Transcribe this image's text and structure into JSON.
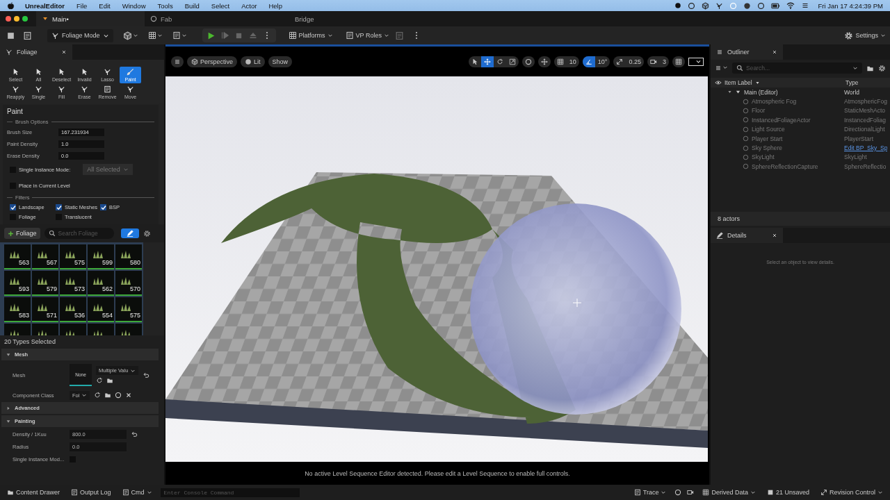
{
  "menubar": {
    "app": "UnrealEditor",
    "items": [
      "File",
      "Edit",
      "Window",
      "Tools",
      "Build",
      "Select",
      "Actor",
      "Help"
    ],
    "clock": "Fri Jan 17  4:24:39 PM"
  },
  "tabs": [
    {
      "label": "Main•",
      "selected": true
    },
    {
      "label": "Fab",
      "selected": false
    }
  ],
  "window_title": "Bridge",
  "toolbar": {
    "mode": "Foliage Mode",
    "platforms": "Platforms",
    "vp_roles": "VP Roles",
    "settings": "Settings"
  },
  "foliage_panel": {
    "title": "Foliage",
    "tools": [
      {
        "label": "Select",
        "selected": false
      },
      {
        "label": "All",
        "selected": false
      },
      {
        "label": "Deselect",
        "selected": false
      },
      {
        "label": "Invalid",
        "selected": false
      },
      {
        "label": "Lasso",
        "selected": false
      },
      {
        "label": "Paint",
        "selected": true
      },
      {
        "label": "Reapply",
        "selected": false
      },
      {
        "label": "Single",
        "selected": false
      },
      {
        "label": "Fill",
        "selected": false
      },
      {
        "label": "Erase",
        "selected": false
      },
      {
        "label": "Remove",
        "selected": false
      },
      {
        "label": "Move",
        "selected": false
      }
    ],
    "heading": "Paint",
    "brush_options": "Brush Options",
    "fields": [
      {
        "label": "Brush Size",
        "value": "167.231934"
      },
      {
        "label": "Paint Density",
        "value": "1.0"
      },
      {
        "label": "Erase Density",
        "value": "0.0"
      }
    ],
    "single_instance": {
      "label": "Single Instance Mode:",
      "checked": false,
      "dropdown": "All Selected"
    },
    "place_in_level": {
      "label": "Place in Current Level",
      "checked": false
    },
    "filters_heading": "Filters",
    "filters": [
      {
        "label": "Landscape",
        "checked": true
      },
      {
        "label": "Static Meshes",
        "checked": true
      },
      {
        "label": "BSP",
        "checked": true
      },
      {
        "label": "Foliage",
        "checked": false
      },
      {
        "label": "Translucent",
        "checked": false
      }
    ],
    "add_button": "Foliage",
    "search_placeholder": "Search Foliage",
    "thumbnails": [
      "563",
      "567",
      "575",
      "599",
      "580",
      "593",
      "579",
      "573",
      "562",
      "570",
      "583",
      "571",
      "536",
      "554",
      "575"
    ],
    "selection": "20 Types Selected",
    "sections": [
      {
        "title": "Mesh",
        "expanded": true,
        "rows": [
          {
            "kind": "mesh",
            "label": "Mesh",
            "thumb": "None",
            "value": "Multiple Valu"
          },
          {
            "kind": "class",
            "label": "Component Class",
            "value": "Fol"
          }
        ]
      },
      {
        "title": "Advanced",
        "expanded": false
      },
      {
        "title": "Painting",
        "expanded": true,
        "rows": [
          {
            "kind": "number",
            "label": "Density / 1Kuu",
            "value": "800.0"
          },
          {
            "kind": "number",
            "label": "Radius",
            "value": "0.0"
          },
          {
            "kind": "check",
            "label": "Single Instance Mod...",
            "checked": false
          }
        ]
      }
    ]
  },
  "viewport": {
    "views": [
      "Perspective",
      "Lit",
      "Show"
    ],
    "grid": "10",
    "angle": "10°",
    "angle_on": true,
    "scale": "0.25",
    "camera": "3",
    "message": "No active Level Sequence Editor detected. Please edit a Level Sequence to enable full controls."
  },
  "outliner": {
    "title": "Outliner",
    "search_placeholder": "Search...",
    "columns": [
      "Item Label",
      "Type"
    ],
    "root": {
      "label": "Main (Editor)",
      "type": "World",
      "expanded": true,
      "children": [
        {
          "label": "Atmospheric Fog",
          "type": "AtmosphericFog",
          "kind": "text"
        },
        {
          "label": "Floor",
          "type": "StaticMeshActo",
          "kind": "text"
        },
        {
          "label": "InstancedFoliageActor",
          "type": "InstancedFoliag",
          "kind": "text"
        },
        {
          "label": "Light Source",
          "type": "DirectionalLight",
          "kind": "text"
        },
        {
          "label": "Player Start",
          "type": "PlayerStart",
          "kind": "text"
        },
        {
          "label": "Sky Sphere",
          "type": "Edit BP_Sky_Sp",
          "kind": "link"
        },
        {
          "label": "SkyLight",
          "type": "SkyLight",
          "kind": "text"
        },
        {
          "label": "SphereReflectionCapture",
          "type": "SphereReflectio",
          "kind": "text"
        }
      ]
    },
    "footer": "8 actors"
  },
  "details": {
    "title": "Details",
    "message": "Select an object to view details."
  },
  "status_bar": {
    "content_drawer": "Content Drawer",
    "output_log": "Output Log",
    "cmd": "Cmd",
    "console_placeholder": "Enter Console Command",
    "trace": "Trace",
    "derived_data": "Derived Data",
    "unsaved": "21 Unsaved",
    "revision": "Revision Control"
  }
}
